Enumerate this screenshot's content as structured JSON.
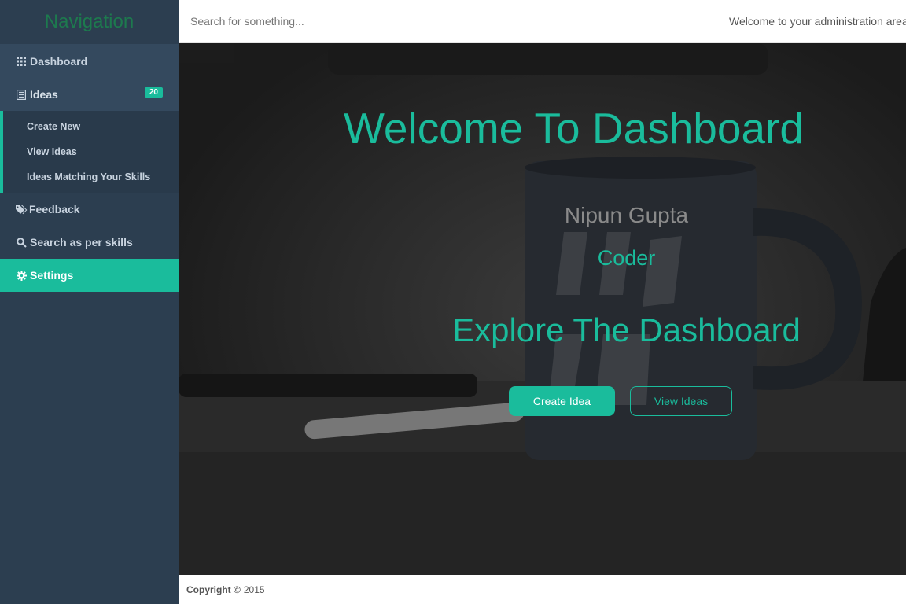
{
  "sidebar": {
    "title": "Navigation",
    "items": {
      "dashboard": {
        "label": "Dashboard",
        "icon": "grid-icon"
      },
      "ideas": {
        "label": "Ideas",
        "icon": "list-icon",
        "badge": "20"
      },
      "feedback": {
        "label": "Feedback",
        "icon": "tags-icon"
      },
      "search_skills": {
        "label": "Search as per skills",
        "icon": "search-icon"
      },
      "settings": {
        "label": "Settings",
        "icon": "gear-icon"
      }
    },
    "submenu": {
      "create_new": "Create New",
      "view_ideas": "View Ideas",
      "matching": "Ideas Matching Your Skills"
    }
  },
  "topbar": {
    "search_placeholder": "Search for something...",
    "welcome": "Welcome to your administration area"
  },
  "hero": {
    "title": "Welcome To Dashboard",
    "name": "Nipun Gupta",
    "role": "Coder",
    "explore": "Explore The Dashboard",
    "primary_button": "Create Idea",
    "secondary_button": "View Ideas"
  },
  "footer": {
    "copyright_label": "Copyright ©",
    "year": "2015"
  },
  "colors": {
    "accent": "#1abc9c",
    "sidebar": "#2c3e50",
    "sidebar_item": "#34495e"
  }
}
